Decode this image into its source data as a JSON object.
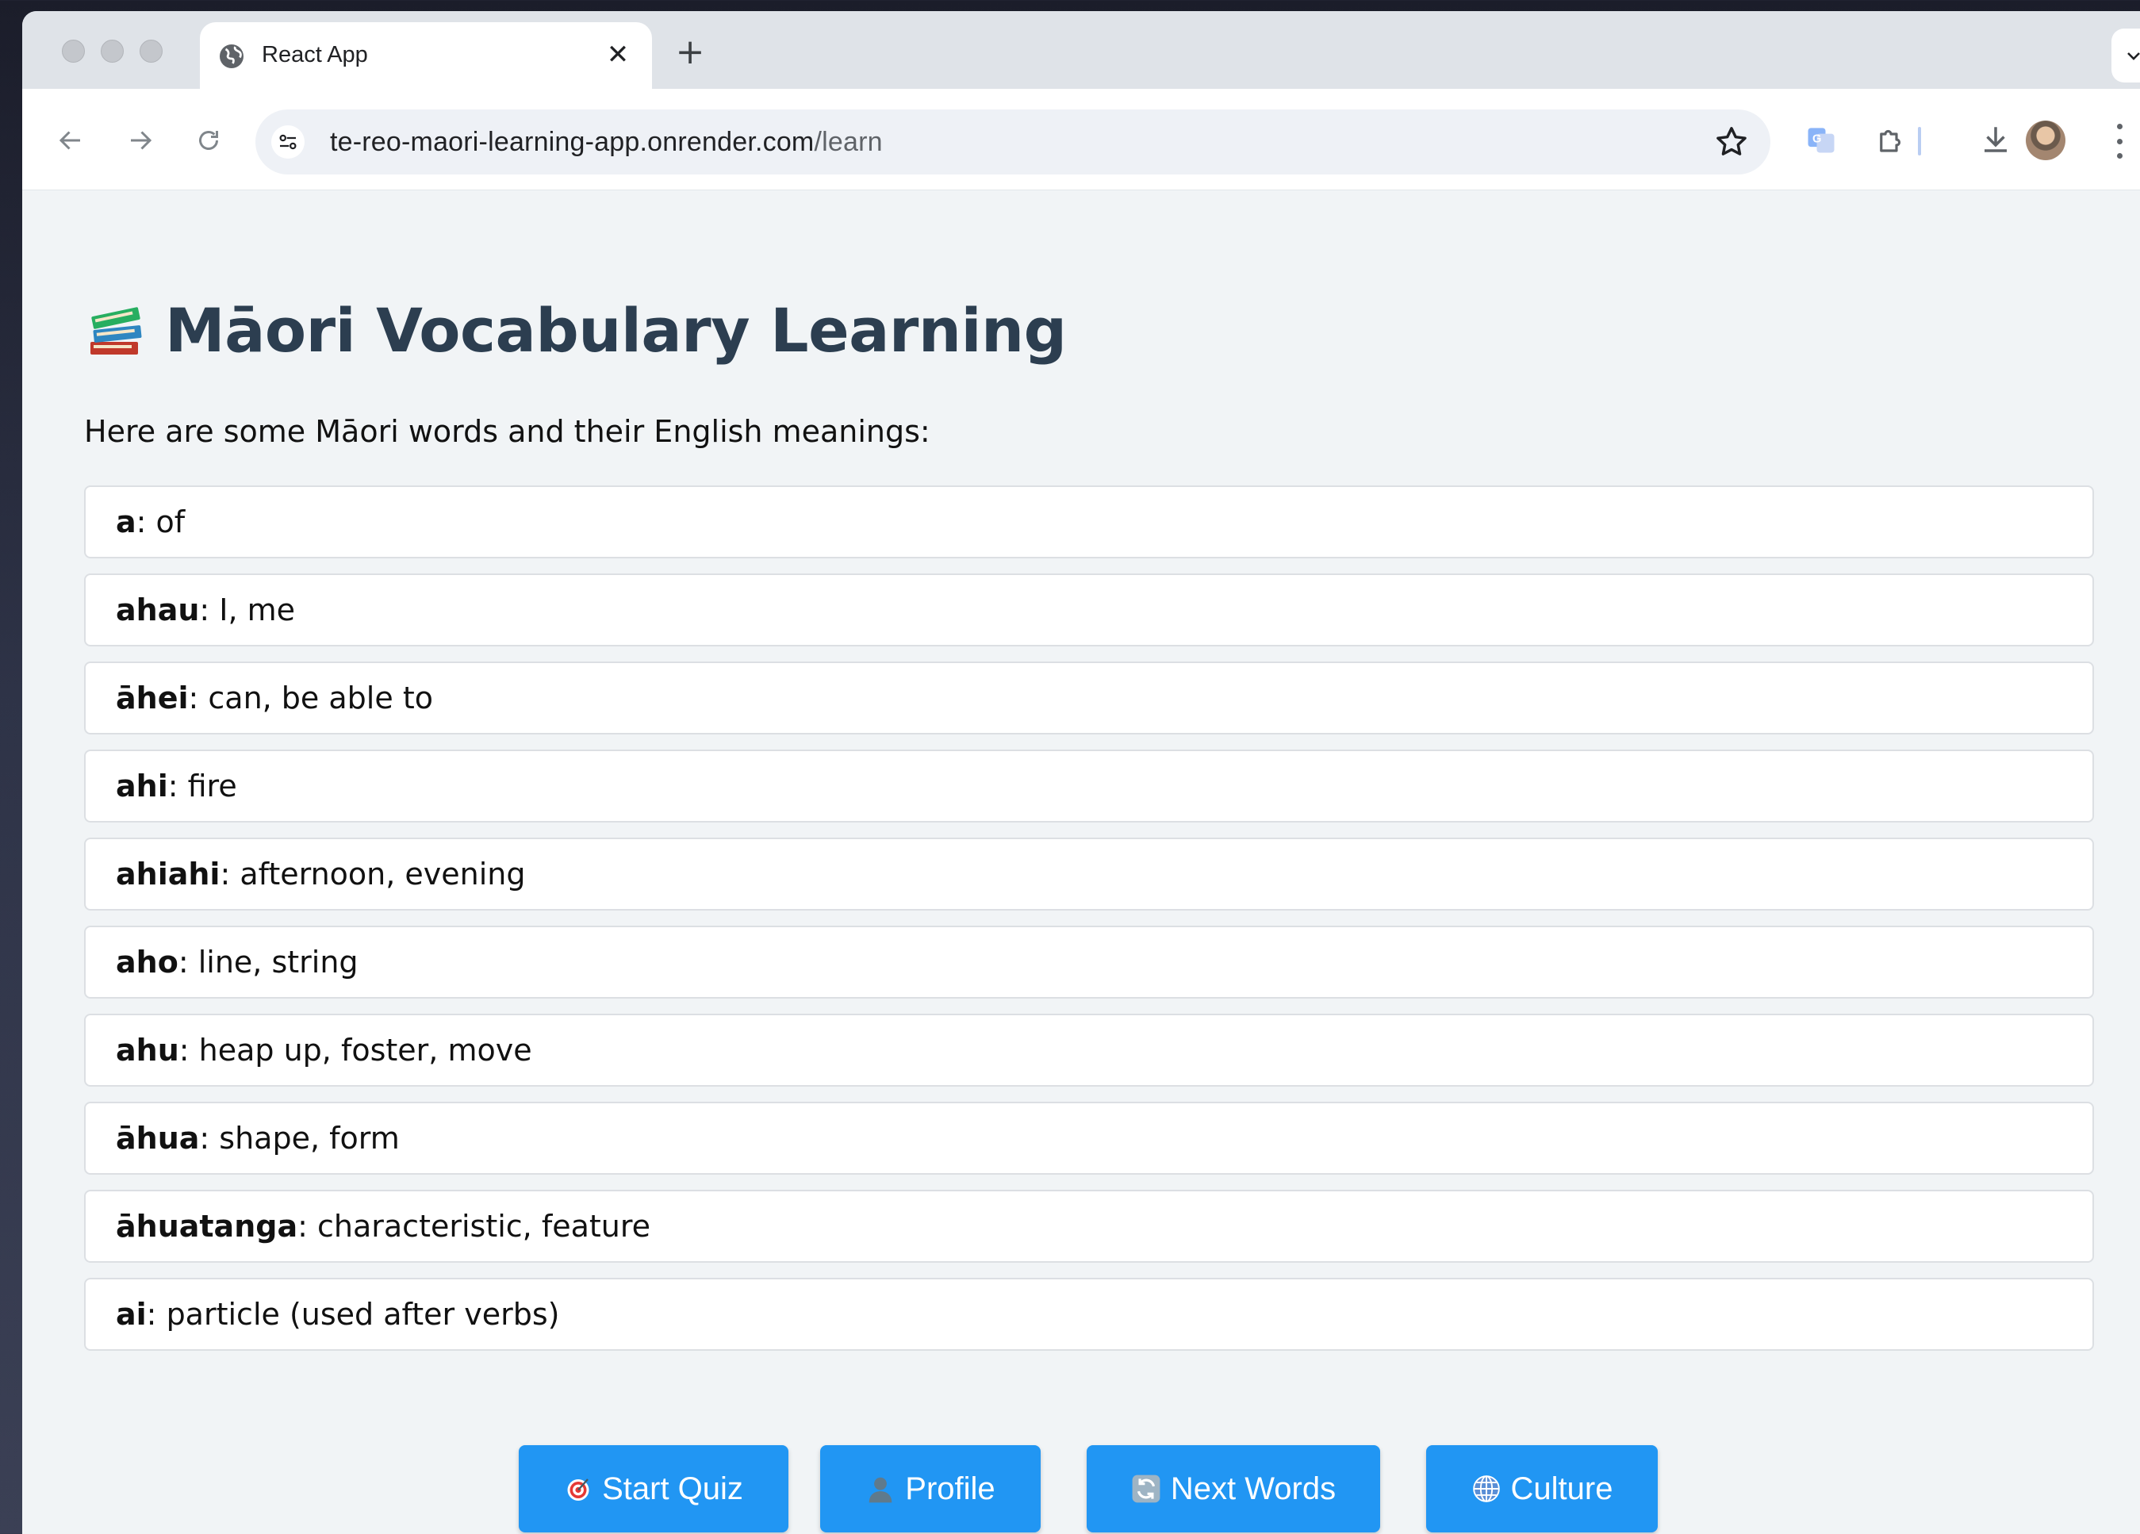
{
  "browser": {
    "tab_title": "React App",
    "tab_close": "✕",
    "new_tab": "+",
    "tab_menu": "⌄",
    "url_host": "te-reo-maori-learning-app.onrender.com",
    "url_path": "/learn"
  },
  "page": {
    "title": "Māori Vocabulary Learning",
    "intro": "Here are some Māori words and their English meanings:",
    "vocab": [
      {
        "word": "a",
        "sep": ": ",
        "meaning": "of"
      },
      {
        "word": "ahau",
        "sep": ": ",
        "meaning": "I, me"
      },
      {
        "word": "āhei",
        "sep": ": ",
        "meaning": "can, be able to"
      },
      {
        "word": "ahi",
        "sep": ": ",
        "meaning": "fire"
      },
      {
        "word": "ahiahi",
        "sep": ": ",
        "meaning": "afternoon, evening"
      },
      {
        "word": "aho",
        "sep": ": ",
        "meaning": "line, string"
      },
      {
        "word": "ahu",
        "sep": ": ",
        "meaning": "heap up, foster, move"
      },
      {
        "word": "āhua",
        "sep": ": ",
        "meaning": "shape, form"
      },
      {
        "word": "āhuatanga",
        "sep": ": ",
        "meaning": "characteristic, feature"
      },
      {
        "word": "ai",
        "sep": ": ",
        "meaning": "particle (used after verbs)"
      }
    ],
    "buttons": {
      "start_quiz": "Start Quiz",
      "profile": "Profile",
      "next_words": "Next Words",
      "culture": "Culture"
    }
  },
  "colors": {
    "heading": "#2c3e50",
    "button": "#2196f3",
    "page_bg": "#f1f4f6"
  }
}
